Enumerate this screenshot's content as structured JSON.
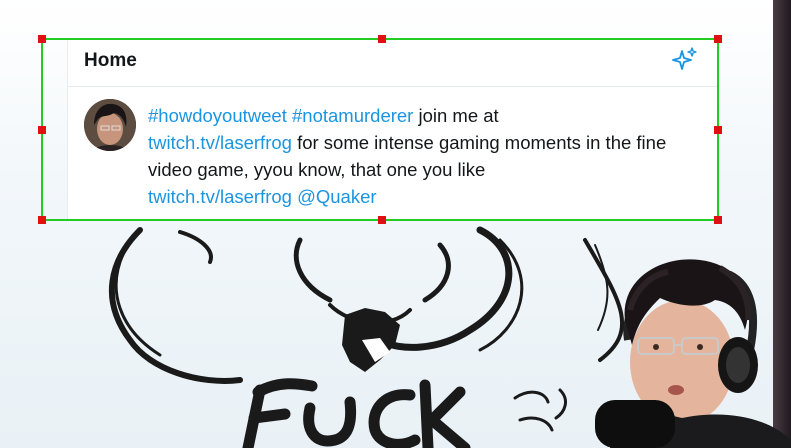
{
  "widget": {
    "title": "Home",
    "icon": "sparkle-icon",
    "accent": "#1b95e0"
  },
  "tweet": {
    "hashtag1": "#howdoyoutweet",
    "hashtag2": "#notamurderer",
    "text1": "join me at",
    "link1": "twitch.tv/laserfrog",
    "text2": "for some intense gaming moments in the fine video game, yyou know, that one you like",
    "link2": "twitch.tv/laserfrog",
    "mention": "@Quaker"
  },
  "background": {
    "drawing_word": "FUCK"
  },
  "selection": {
    "color": "#22cc22",
    "handle_color": "#e01010"
  }
}
